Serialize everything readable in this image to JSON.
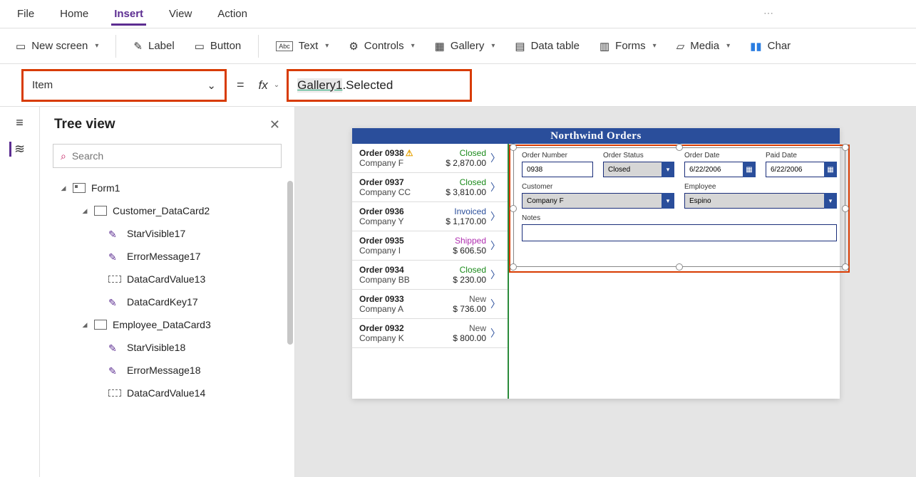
{
  "menu": {
    "file": "File",
    "home": "Home",
    "insert": "Insert",
    "view": "View",
    "action": "Action"
  },
  "ribbon": {
    "new_screen": "New screen",
    "label": "Label",
    "button": "Button",
    "text": "Text",
    "controls": "Controls",
    "gallery": "Gallery",
    "datatable": "Data table",
    "forms": "Forms",
    "media": "Media",
    "charts": "Char"
  },
  "formula": {
    "property": "Item",
    "token_gallery": "Gallery1",
    "token_rest": ".Selected"
  },
  "tree": {
    "title": "Tree view",
    "search_placeholder": "Search",
    "form1": "Form1",
    "customer_card": "Customer_DataCard2",
    "starvisible17": "StarVisible17",
    "errormessage17": "ErrorMessage17",
    "datacardvalue13": "DataCardValue13",
    "datacardkey17": "DataCardKey17",
    "employee_card": "Employee_DataCard3",
    "starvisible18": "StarVisible18",
    "errormessage18": "ErrorMessage18",
    "datacardvalue14": "DataCardValue14"
  },
  "app": {
    "title": "Northwind Orders",
    "gallery": [
      {
        "order": "Order 0938",
        "warn": true,
        "status": "Closed",
        "status_cls": "st-closed",
        "company": "Company F",
        "price": "$ 2,870.00"
      },
      {
        "order": "Order 0937",
        "status": "Closed",
        "status_cls": "st-closed",
        "company": "Company CC",
        "price": "$ 3,810.00"
      },
      {
        "order": "Order 0936",
        "status": "Invoiced",
        "status_cls": "st-invoiced",
        "company": "Company Y",
        "price": "$ 1,170.00"
      },
      {
        "order": "Order 0935",
        "status": "Shipped",
        "status_cls": "st-shipped",
        "company": "Company I",
        "price": "$ 606.50"
      },
      {
        "order": "Order 0934",
        "status": "Closed",
        "status_cls": "st-closed",
        "company": "Company BB",
        "price": "$ 230.00"
      },
      {
        "order": "Order 0933",
        "status": "New",
        "status_cls": "st-new",
        "company": "Company A",
        "price": "$ 736.00"
      },
      {
        "order": "Order 0932",
        "status": "New",
        "status_cls": "st-new",
        "company": "Company K",
        "price": "$ 800.00"
      }
    ],
    "form": {
      "labels": {
        "order_number": "Order Number",
        "order_status": "Order Status",
        "order_date": "Order Date",
        "paid_date": "Paid Date",
        "customer": "Customer",
        "employee": "Employee",
        "notes": "Notes"
      },
      "values": {
        "order_number": "0938",
        "order_status": "Closed",
        "order_date": "6/22/2006",
        "paid_date": "6/22/2006",
        "customer": "Company F",
        "employee": "Espino",
        "notes": ""
      }
    }
  }
}
